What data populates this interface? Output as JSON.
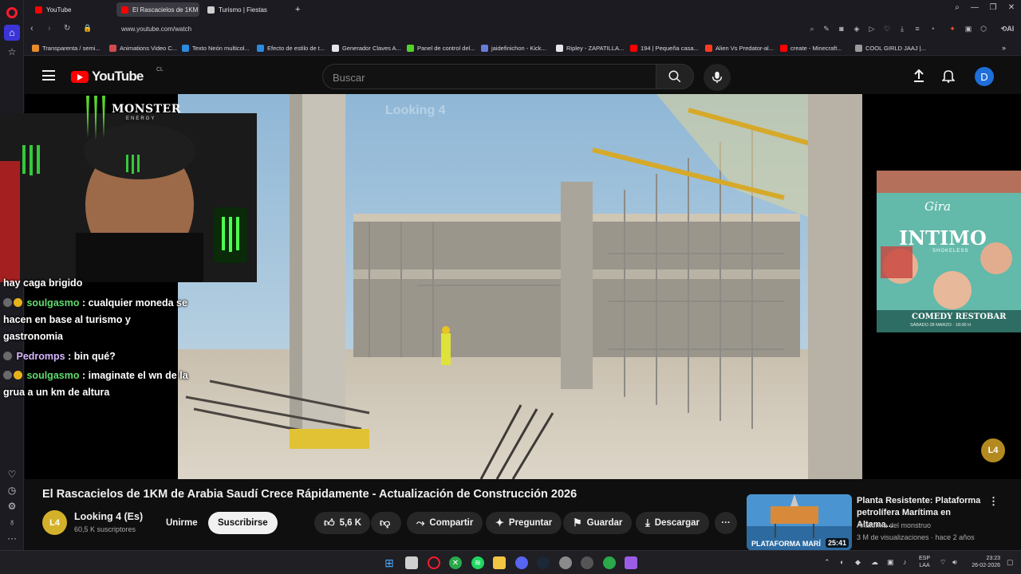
{
  "browser": {
    "tabs": [
      {
        "label": "YouTube",
        "active": false,
        "favicon_color": "#ff0000"
      },
      {
        "label": "El Rascacielos de 1KM",
        "active": true,
        "favicon_color": "#ff0000"
      },
      {
        "label": "Turismo | Fiestas",
        "active": false,
        "favicon_color": "#cfcfcf"
      }
    ],
    "new_tab": "+",
    "url": "www.youtube.com/watch",
    "ai_label": "AI",
    "bookmarks": [
      {
        "label": "Transparenta / semi...",
        "color": "#e88b2c"
      },
      {
        "label": "Animations Video C...",
        "color": "#d14b4b"
      },
      {
        "label": "Texto Neón multicol...",
        "color": "#2a8be0"
      },
      {
        "label": "Efecto de estilo de t...",
        "color": "#2a8be0"
      },
      {
        "label": "Generador Claves A...",
        "color": "#e6e6e6"
      },
      {
        "label": "Panel de control del...",
        "color": "#53d22a"
      },
      {
        "label": "jaidefinichon - Kick...",
        "color": "#6a7bd8"
      },
      {
        "label": "Ripley - ZAPATILLA...",
        "color": "#e6e6e6"
      },
      {
        "label": "194 | Pequeña casa...",
        "color": "#ff0000"
      },
      {
        "label": "Alien Vs Predator-al...",
        "color": "#ff3b1f"
      },
      {
        "label": "create - Minecraft...",
        "color": "#ff0000"
      },
      {
        "label": "COOL GIRLD JAAJ |...",
        "color": "#9a9a9a"
      }
    ]
  },
  "youtube": {
    "logo_text": "YouTube",
    "region": "CL",
    "search_placeholder": "Buscar",
    "avatar_letter": "D"
  },
  "player": {
    "watermark_text": "Looking 4",
    "channel_watermark": "L4"
  },
  "stream_overlay": {
    "monster_text": "MONSTER",
    "monster_sub": "ENERGY",
    "chat": [
      {
        "user": "",
        "text": "hay caga brigido"
      },
      {
        "user": "soulgasmo",
        "text": ": cualquier moneda se"
      },
      {
        "user": "",
        "text": "hacen en base al turismo y"
      },
      {
        "user": "",
        "text": "gastronomia"
      },
      {
        "user": "Pedromps",
        "text": ": bin qué?"
      },
      {
        "user": "soulgasmo",
        "text": ": imaginate el wn de la"
      },
      {
        "user": "",
        "text": "grua a un km de altura"
      }
    ]
  },
  "ad": {
    "title_line": "Gira",
    "main": "INTIMO",
    "sub": "SHOKELESS",
    "venue": "COMEDY RESTOBAR",
    "date": "SÁBADO 28 MARZO · 18:00 H"
  },
  "video": {
    "title": "El Rascacielos de 1KM de Arabia Saudí Crece Rápidamente - Actualización de Construcción 2026",
    "channel": "Looking 4 (Es)",
    "channel_avatar": "L4",
    "subscribers": "60,5 K suscriptores",
    "join_label": "Unirme",
    "subscribe_label": "Suscribirse",
    "likes": "5,6 K",
    "share_label": "Compartir",
    "ask_label": "Preguntar",
    "save_label": "Guardar",
    "download_label": "Descargar",
    "more_label": "···"
  },
  "recommendation": {
    "title": "Planta Resistente: Plataforma petrolífera Marítima en Altama...",
    "channel": "Anatomía del monstruo",
    "views": "3 M de visualizaciones",
    "age": "hace 2 años",
    "duration": "25:41",
    "thumb_text": "PLATAFORMA MARÍ"
  },
  "taskbar": {
    "lang_1": "ESP",
    "lang_2": "LAA",
    "time": "23:23",
    "date": "26-02-2026"
  }
}
